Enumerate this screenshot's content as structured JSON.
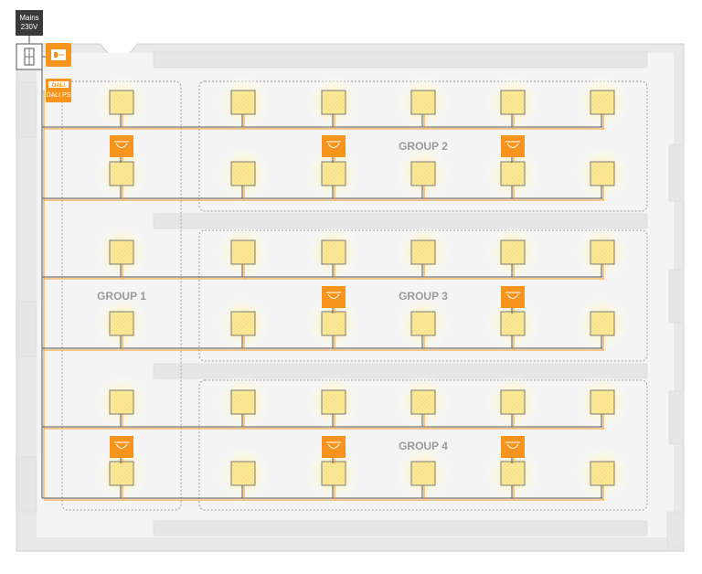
{
  "mains": {
    "line1": "Mains",
    "line2": "230V"
  },
  "devices": {
    "power_supply_logo": "DALI",
    "power_supply_label": "DALI PS"
  },
  "groups": [
    {
      "label": "GROUP 1"
    },
    {
      "label": "GROUP 2"
    },
    {
      "label": "GROUP 3"
    },
    {
      "label": "GROUP 4"
    }
  ],
  "colors": {
    "bus_line": "#f39b2a",
    "mains_line": "#555555",
    "device_orange": "#f7941d",
    "luminaire_fill": "#fbe99a",
    "luminaire_glow": "#fff2a8",
    "floor": "#f2f2f2",
    "mains_box": "#3a3a3a"
  }
}
